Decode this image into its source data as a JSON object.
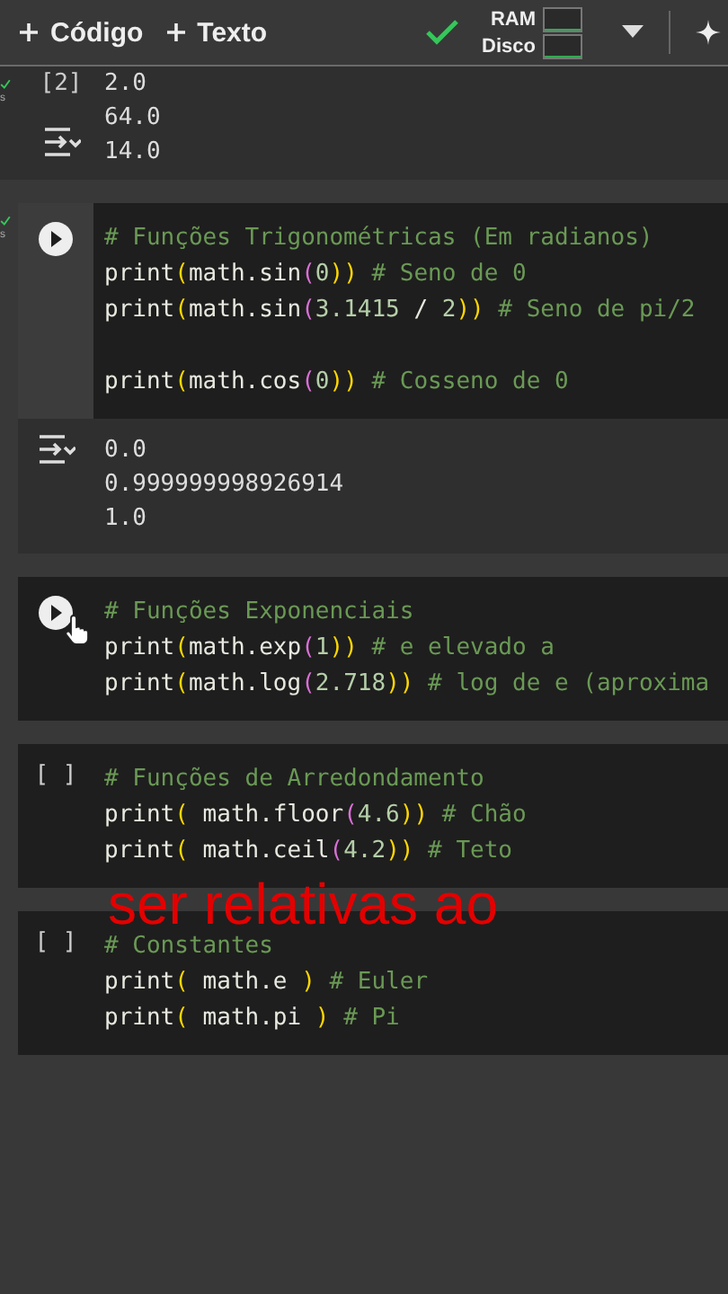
{
  "toolbar": {
    "buttons": [
      {
        "label": "Código"
      },
      {
        "label": "Texto"
      }
    ],
    "connected": true,
    "resources": [
      {
        "label": "RAM"
      },
      {
        "label": "Disco"
      }
    ]
  },
  "cells": [
    {
      "kind": "output_only",
      "done": true,
      "time": "s",
      "counter": "[2]",
      "output": [
        "2.0",
        "64.0",
        "14.0"
      ]
    },
    {
      "kind": "code",
      "focused": true,
      "done": true,
      "time": "s",
      "hovered": false,
      "lines": [
        {
          "kind": "code",
          "tokens": [
            {
              "t": "# Funções Trigonométricas (Em radianos)",
              "kind": "comment"
            }
          ]
        },
        {
          "kind": "code",
          "tokens": [
            {
              "t": "print",
              "kind": "code"
            },
            {
              "t": "(",
              "kind": "paren"
            },
            {
              "t": "math.sin",
              "kind": "code"
            },
            {
              "t": "(",
              "kind": "paren2"
            },
            {
              "t": "0",
              "kind": "num"
            },
            {
              "t": "))",
              "kind": "paren"
            },
            {
              "t": " # Seno de 0",
              "kind": "comment"
            }
          ]
        },
        {
          "kind": "code",
          "tokens": [
            {
              "t": "print",
              "kind": "code"
            },
            {
              "t": "(",
              "kind": "paren"
            },
            {
              "t": "math.sin",
              "kind": "code"
            },
            {
              "t": "(",
              "kind": "paren2"
            },
            {
              "t": "3.1415",
              "kind": "num"
            },
            {
              "t": " / ",
              "kind": "code"
            },
            {
              "t": "2",
              "kind": "num"
            },
            {
              "t": "))",
              "kind": "paren"
            },
            {
              "t": " # Seno de pi/2",
              "kind": "comment"
            }
          ]
        },
        {
          "kind": "blank"
        },
        {
          "kind": "code",
          "tokens": [
            {
              "t": "print",
              "kind": "code"
            },
            {
              "t": "(",
              "kind": "paren"
            },
            {
              "t": "math.cos",
              "kind": "code"
            },
            {
              "t": "(",
              "kind": "paren2"
            },
            {
              "t": "0",
              "kind": "num"
            },
            {
              "t": "))",
              "kind": "paren"
            },
            {
              "t": " # Cosseno de 0",
              "kind": "comment"
            }
          ]
        }
      ],
      "output": [
        "0.0",
        "0.999999998926914",
        "1.0"
      ]
    },
    {
      "kind": "code",
      "focused": false,
      "done": false,
      "hovered": true,
      "lines": [
        {
          "kind": "code",
          "tokens": [
            {
              "t": "# Funções Exponenciais",
              "kind": "comment"
            }
          ]
        },
        {
          "kind": "code",
          "tokens": [
            {
              "t": "print",
              "kind": "code"
            },
            {
              "t": "(",
              "kind": "paren"
            },
            {
              "t": "math.exp",
              "kind": "code"
            },
            {
              "t": "(",
              "kind": "paren2"
            },
            {
              "t": "1",
              "kind": "num"
            },
            {
              "t": "))",
              "kind": "paren"
            },
            {
              "t": " # e elevado a",
              "kind": "comment"
            }
          ]
        },
        {
          "kind": "code",
          "tokens": [
            {
              "t": "print",
              "kind": "code"
            },
            {
              "t": "(",
              "kind": "paren"
            },
            {
              "t": "math.log",
              "kind": "code"
            },
            {
              "t": "(",
              "kind": "paren2"
            },
            {
              "t": "2.718",
              "kind": "num"
            },
            {
              "t": "))",
              "kind": "paren"
            },
            {
              "t": " # log de e (aproxima",
              "kind": "comment"
            }
          ]
        }
      ]
    },
    {
      "kind": "code",
      "counter": "[ ]",
      "focused": false,
      "done": false,
      "hovered": false,
      "lines": [
        {
          "kind": "code",
          "tokens": [
            {
              "t": "# Funções de Arredondamento",
              "kind": "comment"
            }
          ]
        },
        {
          "kind": "code",
          "tokens": [
            {
              "t": "print",
              "kind": "code"
            },
            {
              "t": "(",
              "kind": "paren"
            },
            {
              "t": " math.floor",
              "kind": "code"
            },
            {
              "t": "(",
              "kind": "paren2"
            },
            {
              "t": "4.6",
              "kind": "num"
            },
            {
              "t": "))",
              "kind": "paren"
            },
            {
              "t": " # Chão",
              "kind": "comment"
            }
          ]
        },
        {
          "kind": "code",
          "tokens": [
            {
              "t": "print",
              "kind": "code"
            },
            {
              "t": "(",
              "kind": "paren"
            },
            {
              "t": " math.ceil",
              "kind": "code"
            },
            {
              "t": "(",
              "kind": "paren2"
            },
            {
              "t": "4.2",
              "kind": "num"
            },
            {
              "t": "))",
              "kind": "paren"
            },
            {
              "t": " # Teto",
              "kind": "comment"
            }
          ]
        }
      ]
    },
    {
      "kind": "code",
      "counter": "[ ]",
      "focused": false,
      "done": false,
      "hovered": false,
      "lines": [
        {
          "kind": "code",
          "tokens": [
            {
              "t": "# Constantes",
              "kind": "comment"
            }
          ]
        },
        {
          "kind": "code",
          "tokens": [
            {
              "t": "print",
              "kind": "code"
            },
            {
              "t": "(",
              "kind": "paren"
            },
            {
              "t": " math.e ",
              "kind": "code"
            },
            {
              "t": ")",
              "kind": "paren"
            },
            {
              "t": " # Euler",
              "kind": "comment"
            }
          ]
        },
        {
          "kind": "code",
          "tokens": [
            {
              "t": "print",
              "kind": "code"
            },
            {
              "t": "(",
              "kind": "paren"
            },
            {
              "t": " math.pi ",
              "kind": "code"
            },
            {
              "t": ")",
              "kind": "paren"
            },
            {
              "t": " # Pi",
              "kind": "comment"
            }
          ]
        }
      ]
    }
  ],
  "caption": "ser relativas ao"
}
